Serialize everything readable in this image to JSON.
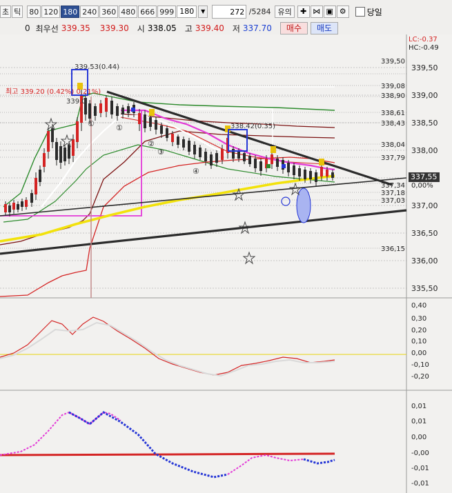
{
  "toolbar": {
    "tick_btn": "초",
    "tick_btn2": "틱",
    "periods": [
      "80",
      "120",
      "180",
      "240",
      "360",
      "480",
      "666",
      "999"
    ],
    "active_period": "180",
    "period_select": "180",
    "count_value": "272",
    "count_total": "/5284",
    "btn_yui": "유의",
    "checkbox_label": "당일",
    "row2_zero": "0",
    "row2_label": "최우선",
    "best_ask": "339.35",
    "best_bid": "339.30",
    "open_label": "시",
    "open_value": "338.05",
    "high_label": "고",
    "high_value": "339.40",
    "low_label": "저",
    "low_value": "337.70",
    "buy_label": "매수",
    "sell_label": "매도"
  },
  "price_axis": {
    "labels": [
      "339,50",
      "339,00",
      "338,50",
      "338,00",
      "337,50",
      "337,00",
      "336,50",
      "336,00",
      "335,50"
    ],
    "lc": "LC:-0.37",
    "hc": "HC:-0.49",
    "current": "337,55",
    "zero_pct": "0,00%",
    "right_level_labels": [
      "339,08",
      "338,90",
      "338,61",
      "338,43",
      "338,04",
      "337,79",
      "337,34",
      "337,18",
      "337,03",
      "336,15"
    ],
    "top_level": "339,50"
  },
  "annotations": {
    "high_value": "339.53(0.44)",
    "left_note": "최고 339.20 (0.42%) 0.21%)",
    "mid_note": "338.42(0.35)",
    "mark_339": "339.0",
    "circles": [
      "①",
      "①",
      "②",
      "③",
      "④"
    ]
  },
  "osc1_axis": [
    "0,40",
    "0,30",
    "0,20",
    "0,10",
    "0,00",
    "-0,10",
    "-0,20"
  ],
  "osc2_axis": [
    "0,01",
    "0,01",
    "0,00",
    "-0,00",
    "-0,01",
    "-0,01"
  ],
  "colors": {
    "bg": "#f2f1ef",
    "grid": "#9a9a9a",
    "trend": "#2b2b2b",
    "yellow": "#f2e20b",
    "magenta": "#e33ad7",
    "green": "#2b8a2b",
    "darkred": "#7b1010",
    "red": "#d42323",
    "blue": "#2536d6"
  }
}
